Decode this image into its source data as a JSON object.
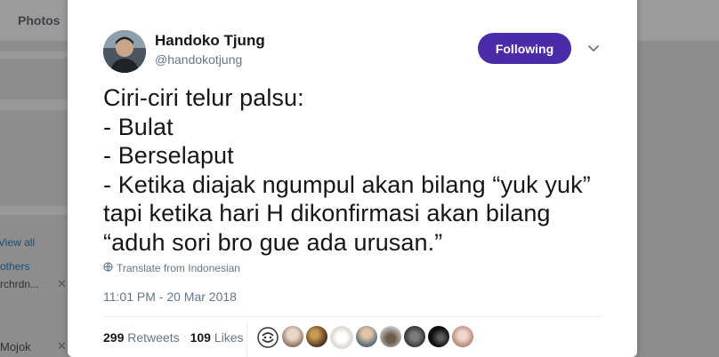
{
  "background": {
    "tab_photos": "Photos",
    "view_all": "View all",
    "others": "others",
    "truncated_handle": "rchrdn...",
    "mojok": "Mojok"
  },
  "tweet": {
    "display_name": "Handoko Tjung",
    "handle": "@handokotjung",
    "follow_label": "Following",
    "text_lines": [
      "Ciri-ciri telur palsu:",
      "- Bulat",
      "- Berselaput",
      "- Ketika diajak ngumpul akan bilang “yuk yuk”",
      "tapi ketika hari H dikonfirmasi akan bilang",
      "“aduh sori bro gue ada urusan.”"
    ],
    "translate_label": "Translate from Indonesian",
    "timestamp": "11:01 PM - 20 Mar 2018",
    "retweets_count": "299",
    "retweets_label": "Retweets",
    "likes_count": "109",
    "likes_label": "Likes"
  },
  "colors": {
    "follow_button": "#4b2ba8",
    "secondary_text": "#657786"
  }
}
